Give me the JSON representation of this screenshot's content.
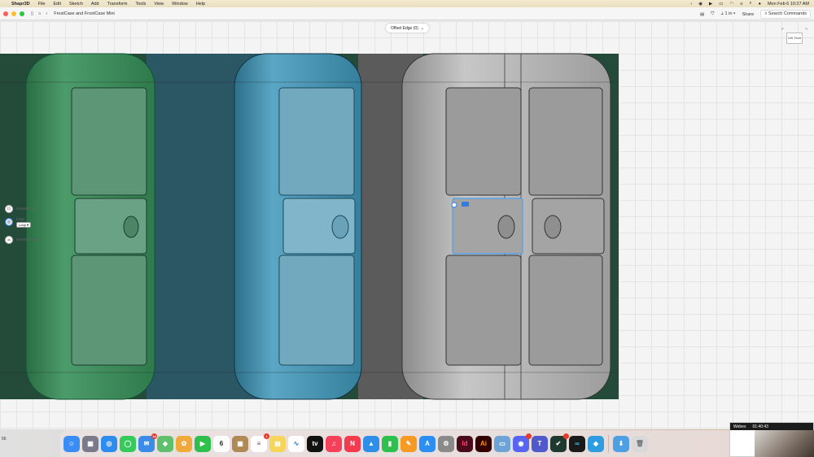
{
  "menubar": {
    "app_name": "Shapr3D",
    "menus": [
      "File",
      "Edit",
      "Sketch",
      "Add",
      "Transform",
      "Tools",
      "View",
      "Window",
      "Help"
    ],
    "clock": "Mon Feb 6  10:27 AM"
  },
  "titlebar": {
    "document_title": "FrostCase and FrostCase Mini",
    "units": "1 in",
    "share_label": "Share",
    "search_placeholder": "Search Commands"
  },
  "canvas": {
    "offset_tool_label": "Offset Edge (0)",
    "viewcube": {
      "left": "Left",
      "front": "Front"
    },
    "left_panel": {
      "items": [
        {
          "label": "Deselect All",
          "icon": "deselect-icon"
        },
        {
          "label": "Edge",
          "icon": "edge-select-icon",
          "chip": "Loop"
        },
        {
          "label": "Measurements",
          "icon": "measure-icon"
        }
      ]
    },
    "bodies": [
      {
        "name": "green-case",
        "color": "#3b8a5a"
      },
      {
        "name": "blue-case",
        "color": "#3f8fab"
      },
      {
        "name": "gray-case-1",
        "color": "#a9a9a9"
      },
      {
        "name": "gray-case-2",
        "color": "#b2b2b2"
      }
    ],
    "colors": {
      "accent": "#2f7de1",
      "selection": "#4aa0ef"
    }
  },
  "dock": {
    "apps": [
      {
        "name": "Finder",
        "color": "#3a8df5",
        "glyph": "☺"
      },
      {
        "name": "Launchpad",
        "color": "#7a7a8a",
        "glyph": "▦"
      },
      {
        "name": "Safari",
        "color": "#2d8cf0",
        "glyph": "◎"
      },
      {
        "name": "Messages",
        "color": "#36c95c",
        "glyph": "◯"
      },
      {
        "name": "Mail",
        "color": "#3d8be8",
        "glyph": "✉",
        "badge": "14"
      },
      {
        "name": "Maps",
        "color": "#5fbf6c",
        "glyph": "◈"
      },
      {
        "name": "Photos",
        "color": "#f2a93b",
        "glyph": "✿"
      },
      {
        "name": "FaceTime",
        "color": "#2fbf4d",
        "glyph": "▶"
      },
      {
        "name": "Calendar",
        "color": "#ffffff",
        "glyph": "6",
        "text_color": "#222"
      },
      {
        "name": "Notes Archive",
        "color": "#b08a55",
        "glyph": "▣"
      },
      {
        "name": "Reminders",
        "color": "#ffffff",
        "glyph": "≡",
        "text_color": "#555",
        "badge": "1"
      },
      {
        "name": "Notes",
        "color": "#f6d65a",
        "glyph": "▤"
      },
      {
        "name": "Freeform",
        "color": "#ffffff",
        "glyph": "∿",
        "text_color": "#2a7adf"
      },
      {
        "name": "TV",
        "color": "#111111",
        "glyph": "tv"
      },
      {
        "name": "Music",
        "color": "#f5405a",
        "glyph": "♫"
      },
      {
        "name": "News",
        "color": "#f33a4f",
        "glyph": "N"
      },
      {
        "name": "Keynote",
        "color": "#2e8fe8",
        "glyph": "▲"
      },
      {
        "name": "Numbers",
        "color": "#2fbf4d",
        "glyph": "▮"
      },
      {
        "name": "Pages",
        "color": "#f59a23",
        "glyph": "✎"
      },
      {
        "name": "App Store",
        "color": "#2b8ef2",
        "glyph": "A"
      },
      {
        "name": "System Settings",
        "color": "#8a8a8a",
        "glyph": "⚙"
      },
      {
        "name": "InDesign",
        "color": "#4a0a1c",
        "glyph": "Id",
        "text_color": "#ff3c6d"
      },
      {
        "name": "Illustrator",
        "color": "#330000",
        "glyph": "Ai",
        "text_color": "#ff9a00"
      },
      {
        "name": "Preview",
        "color": "#6ea3d8",
        "glyph": "▭"
      },
      {
        "name": "Discord",
        "color": "#5865f2",
        "glyph": "◉",
        "badge": ""
      },
      {
        "name": "Teams",
        "color": "#5059c9",
        "glyph": "T"
      },
      {
        "name": "Shapr3D",
        "color": "#1f3a2f",
        "glyph": "✔",
        "badge": ""
      },
      {
        "name": "Webex",
        "color": "#1a1a1a",
        "glyph": "∞",
        "text_color": "#3ec1f0"
      },
      {
        "name": "Shapr3D Alt",
        "color": "#2d9de0",
        "glyph": "◆"
      }
    ],
    "trailing": [
      {
        "name": "Downloads",
        "color": "#4f9fe5",
        "glyph": "⬇"
      },
      {
        "name": "Trash",
        "color": "#d9d9d9",
        "glyph": "🗑",
        "text_color": "#777"
      }
    ]
  },
  "bottom_left_text": "56",
  "webex": {
    "label": "Webex",
    "timer": "01:40:43"
  }
}
